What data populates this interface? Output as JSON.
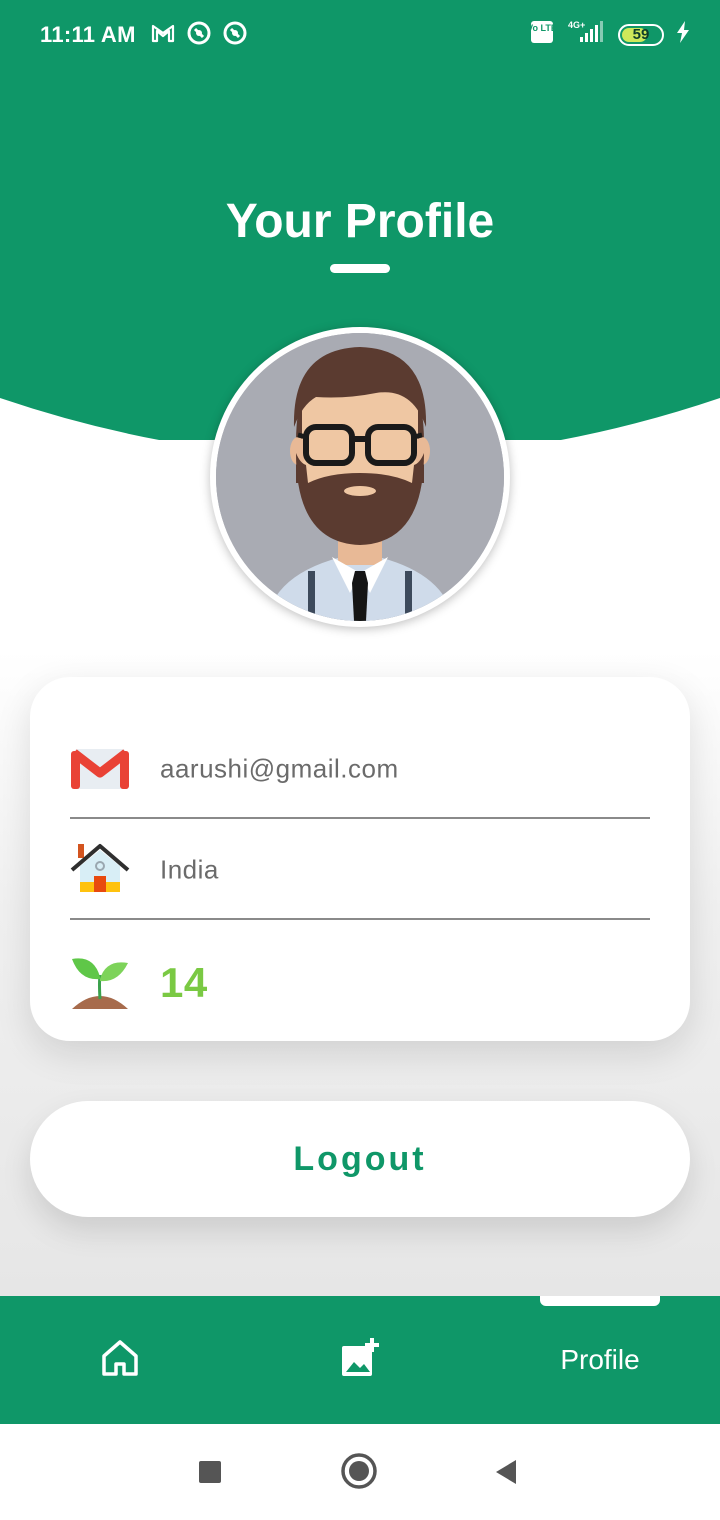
{
  "colors": {
    "brand_green": "#0f9768",
    "text_gray": "#6b6b6b",
    "count_green": "#7ac943",
    "white": "#ffffff"
  },
  "status_bar": {
    "time": "11:11 AM",
    "left_icons": [
      "gmail-icon",
      "notification-icon",
      "notification-icon"
    ],
    "right_icons": [
      "volte-icon",
      "signal-4g-icon",
      "battery-icon",
      "charging-icon"
    ],
    "network_label": "4G+",
    "volte_label": "Vo LTE",
    "battery_level": "59"
  },
  "header": {
    "title": "Your Profile"
  },
  "profile": {
    "avatar_icon": "bearded-man-avatar"
  },
  "info": {
    "email": "aarushi@gmail.com",
    "email_icon": "gmail-icon",
    "country": "India",
    "country_icon": "house-icon",
    "plants_count": "14",
    "plants_icon": "sprout-icon"
  },
  "actions": {
    "logout_label": "Logout"
  },
  "bottom_nav": {
    "items": [
      {
        "icon": "home-icon"
      },
      {
        "icon": "add-image-icon"
      },
      {
        "label": "Profile"
      }
    ],
    "active_index": 2
  },
  "system_nav": {
    "items": [
      "recents-square-icon",
      "home-circle-icon",
      "back-triangle-icon"
    ]
  }
}
